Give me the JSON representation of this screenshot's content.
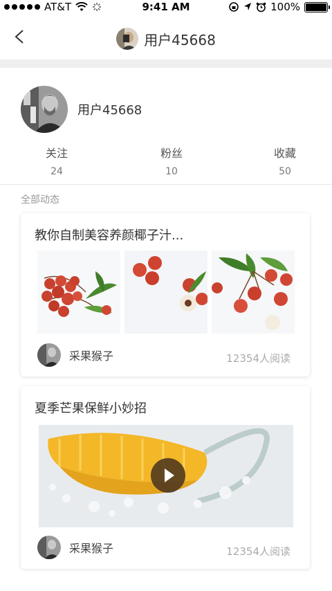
{
  "status_bar": {
    "carrier": "AT&T",
    "time": "9:41 AM",
    "battery": "100%"
  },
  "nav": {
    "title": "用户45668",
    "back_icon": "chevron-left-icon"
  },
  "profile": {
    "username": "用户45668",
    "stats": [
      {
        "label": "关注",
        "value": "24"
      },
      {
        "label": "粉丝",
        "value": "10"
      },
      {
        "label": "收藏",
        "value": "50"
      }
    ]
  },
  "feed": {
    "section_label": "全部动态",
    "posts": [
      {
        "title": "教你自制美容养颜椰子汁...",
        "author": "采果猴子",
        "reads": "12354人阅读"
      },
      {
        "title": "夏季芒果保鲜小妙招",
        "author": "采果猴子",
        "reads": "12354人阅读"
      }
    ]
  },
  "colors": {
    "background": "#ffffff",
    "separator": "#efefef",
    "muted_text": "#aaaaaa"
  }
}
